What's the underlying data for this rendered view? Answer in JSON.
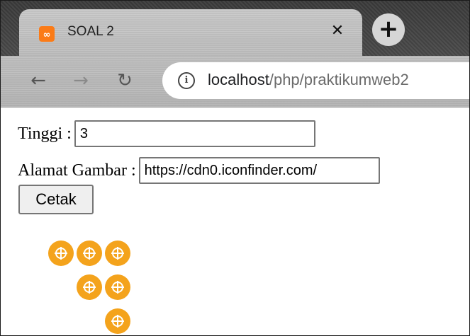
{
  "browser": {
    "tab": {
      "favicon_glyph": "ཀ",
      "title": "SOAL 2",
      "close_glyph": "✕"
    },
    "newtab_glyph": "+",
    "nav": {
      "back_glyph": "←",
      "forward_glyph": "→",
      "reload_glyph": "↻"
    },
    "info_glyph": "i",
    "url": {
      "host": "localhost",
      "path": "/php/praktikumweb2"
    }
  },
  "form": {
    "tinggi": {
      "label": "Tinggi :",
      "value": "3"
    },
    "alamat": {
      "label": "Alamat Gambar :",
      "value": "https://cdn0.iconfinder.com/"
    },
    "submit_label": "Cetak"
  },
  "output": {
    "rows": [
      3,
      2,
      1
    ],
    "icon_name": "xampp-icon",
    "icon_color": "#f4a31c"
  }
}
